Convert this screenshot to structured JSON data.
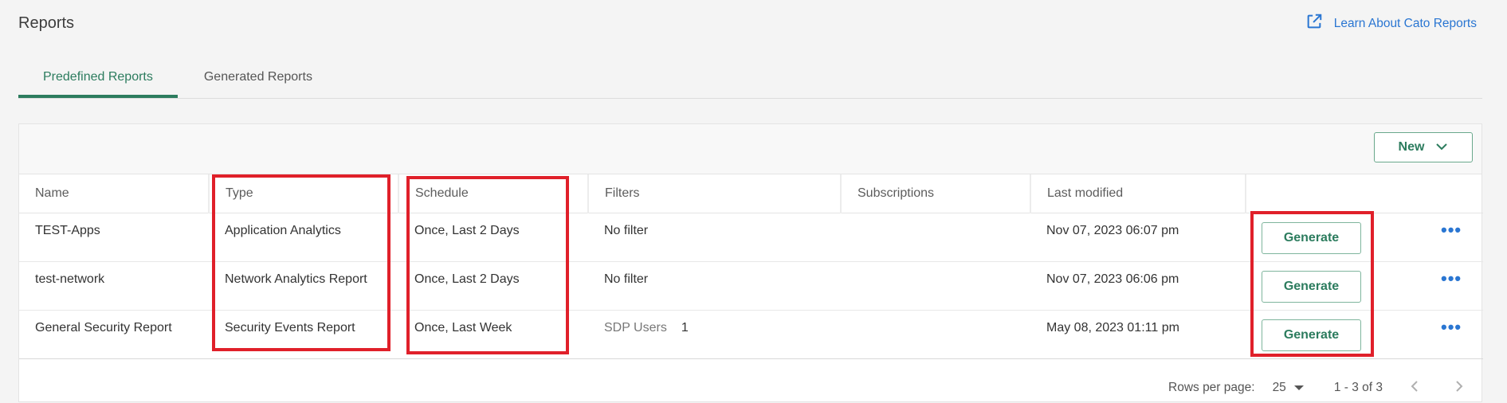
{
  "header": {
    "title": "Reports",
    "learn_link": "Learn About Cato Reports"
  },
  "tabs": [
    {
      "label": "Predefined Reports",
      "active": true
    },
    {
      "label": "Generated Reports",
      "active": false
    }
  ],
  "toolbar": {
    "new_label": "New"
  },
  "table": {
    "columns": [
      "Name",
      "Type",
      "Schedule",
      "Filters",
      "Subscriptions",
      "Last modified",
      ""
    ],
    "rows": [
      {
        "name": "TEST-Apps",
        "type": "Application Analytics",
        "schedule": "Once, Last 2 Days",
        "filter_name": "No filter",
        "filter_count": "",
        "subscriptions": "",
        "last_modified": "Nov 07, 2023 06:07 pm",
        "action": "Generate"
      },
      {
        "name": "test-network",
        "type": "Network Analytics Report",
        "schedule": "Once, Last 2 Days",
        "filter_name": "No filter",
        "filter_count": "",
        "subscriptions": "",
        "last_modified": "Nov 07, 2023 06:06 pm",
        "action": "Generate"
      },
      {
        "name": "General Security Report",
        "type": "Security Events Report",
        "schedule": "Once, Last Week",
        "filter_name": "SDP Users",
        "filter_count": "1",
        "subscriptions": "",
        "last_modified": "May 08, 2023 01:11 pm",
        "action": "Generate"
      }
    ],
    "more_glyph": "•••"
  },
  "pagination": {
    "rows_per_page_label": "Rows per page:",
    "rows_per_page_value": "25",
    "range": "1 - 3 of 3"
  },
  "colors": {
    "accent_green": "#2c7c5e",
    "link_blue": "#2a76d2",
    "highlight_red": "#e0202a"
  },
  "icons": {
    "external_link": "external-link-icon",
    "new_dropdown": "chevron-down-icon",
    "prev_page": "chevron-left-icon",
    "next_page": "chevron-right-icon",
    "row_menu": "more-horizontal-icon"
  }
}
